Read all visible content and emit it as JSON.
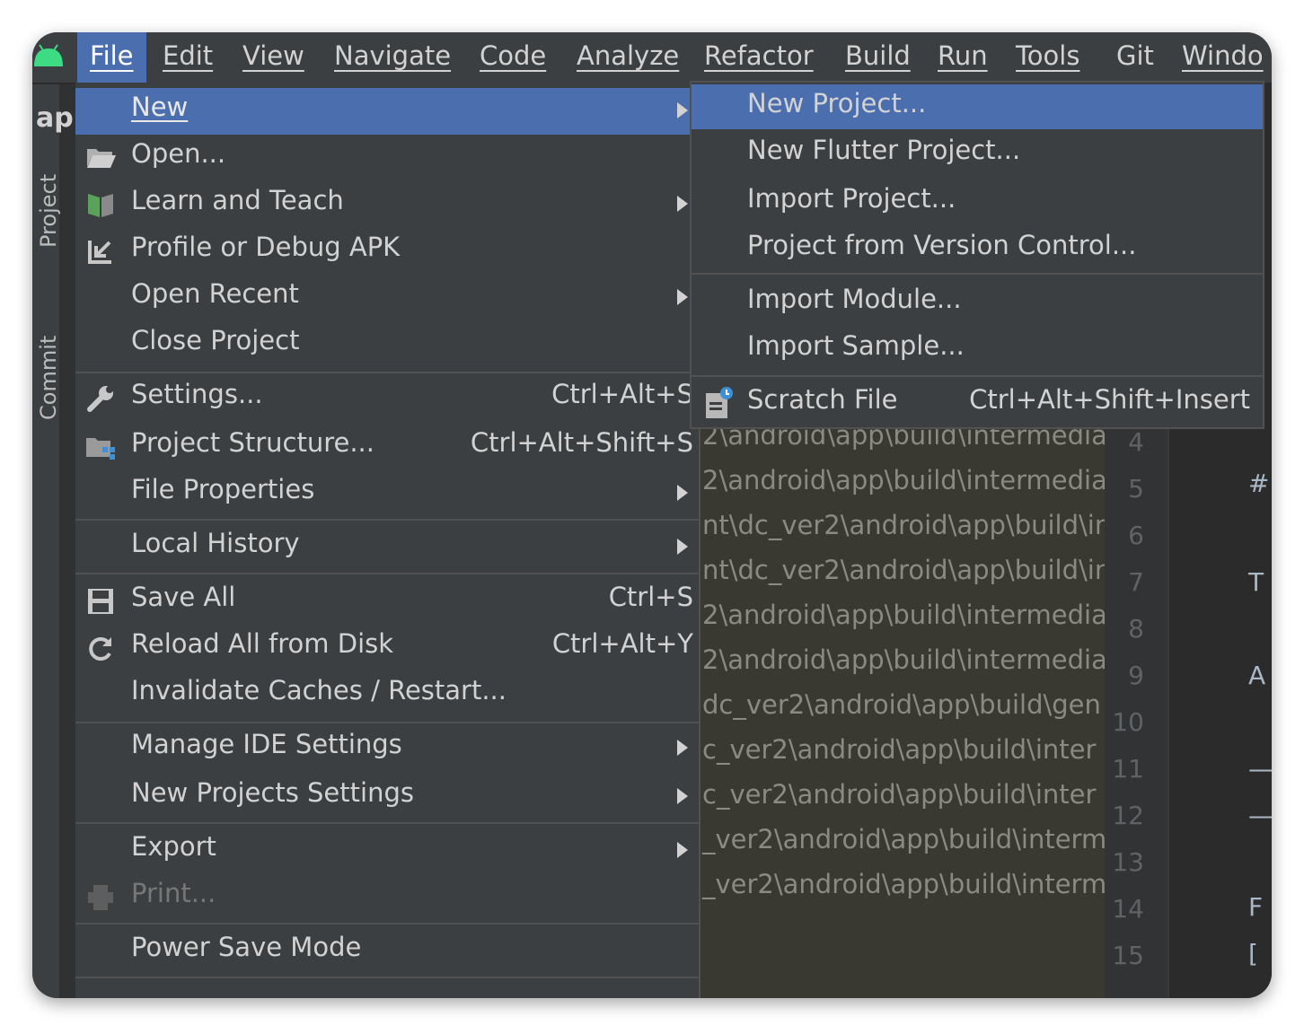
{
  "menubar": {
    "items": [
      "File",
      "Edit",
      "View",
      "Navigate",
      "Code",
      "Analyze",
      "Refactor",
      "Build",
      "Run",
      "Tools",
      "Git",
      "Windo"
    ]
  },
  "sidebar": {
    "app_label": "ap",
    "project_tab": "Project",
    "commit_tab": "Commit"
  },
  "file_menu": {
    "items": [
      {
        "label": "New",
        "shortcut": "",
        "submenu": true,
        "icon": "none"
      },
      {
        "label": "Open...",
        "shortcut": "",
        "submenu": false,
        "icon": "folder-icon"
      },
      {
        "label": "Learn and Teach",
        "shortcut": "",
        "submenu": true,
        "icon": "book-icon"
      },
      {
        "label": "Profile or Debug APK",
        "shortcut": "",
        "submenu": false,
        "icon": "import-arrow-icon"
      },
      {
        "label": "Open Recent",
        "shortcut": "",
        "submenu": true,
        "icon": "none"
      },
      {
        "label": "Close Project",
        "shortcut": "",
        "submenu": false,
        "icon": "none"
      },
      {
        "label": "Settings...",
        "shortcut": "Ctrl+Alt+S",
        "submenu": false,
        "icon": "wrench-icon"
      },
      {
        "label": "Project Structure...",
        "shortcut": "Ctrl+Alt+Shift+S",
        "submenu": false,
        "icon": "project-structure-icon"
      },
      {
        "label": "File Properties",
        "shortcut": "",
        "submenu": true,
        "icon": "none"
      },
      {
        "label": "Local History",
        "shortcut": "",
        "submenu": true,
        "icon": "none"
      },
      {
        "label": "Save All",
        "shortcut": "Ctrl+S",
        "submenu": false,
        "icon": "save-icon"
      },
      {
        "label": "Reload All from Disk",
        "shortcut": "Ctrl+Alt+Y",
        "submenu": false,
        "icon": "reload-icon"
      },
      {
        "label": "Invalidate Caches / Restart...",
        "shortcut": "",
        "submenu": false,
        "icon": "none"
      },
      {
        "label": "Manage IDE Settings",
        "shortcut": "",
        "submenu": true,
        "icon": "none"
      },
      {
        "label": "New Projects Settings",
        "shortcut": "",
        "submenu": true,
        "icon": "none"
      },
      {
        "label": "Export",
        "shortcut": "",
        "submenu": true,
        "icon": "none"
      },
      {
        "label": "Print...",
        "shortcut": "",
        "submenu": false,
        "icon": "printer-icon",
        "disabled": true
      },
      {
        "label": "Power Save Mode",
        "shortcut": "",
        "submenu": false,
        "icon": "none"
      }
    ]
  },
  "new_submenu": {
    "items": [
      {
        "label": "New Project...",
        "shortcut": ""
      },
      {
        "label": "New Flutter Project...",
        "shortcut": ""
      },
      {
        "label": "Import Project...",
        "shortcut": ""
      },
      {
        "label": "Project from Version Control...",
        "shortcut": ""
      },
      {
        "label": "Import Module...",
        "shortcut": ""
      },
      {
        "label": "Import Sample...",
        "shortcut": ""
      },
      {
        "label": "Scratch File",
        "shortcut": "Ctrl+Alt+Shift+Insert",
        "icon": "scratch-file-icon"
      }
    ]
  },
  "output_lines": [
    "2\\android\\app\\build\\intermedia",
    "2\\android\\app\\build\\intermedia",
    "nt\\dc_ver2\\android\\app\\build\\in",
    "nt\\dc_ver2\\android\\app\\build\\in",
    "2\\android\\app\\build\\intermedia",
    "2\\android\\app\\build\\intermedia",
    "dc_ver2\\android\\app\\build\\gen",
    "c_ver2\\android\\app\\build\\inter",
    "c_ver2\\android\\app\\build\\inter",
    "_ver2\\android\\app\\build\\interm",
    "_ver2\\android\\app\\build\\interm"
  ],
  "line_numbers": [
    "4",
    "5",
    "6",
    "7",
    "8",
    "9",
    "10",
    "11",
    "12",
    "13",
    "14",
    "15"
  ],
  "editor_chars": [
    "#",
    "T",
    "A",
    "—",
    "—",
    "F",
    "["
  ],
  "colors": {
    "menu_bg": "#3c3f41",
    "highlight": "#4b6eaf",
    "text": "#d2d2d2"
  }
}
